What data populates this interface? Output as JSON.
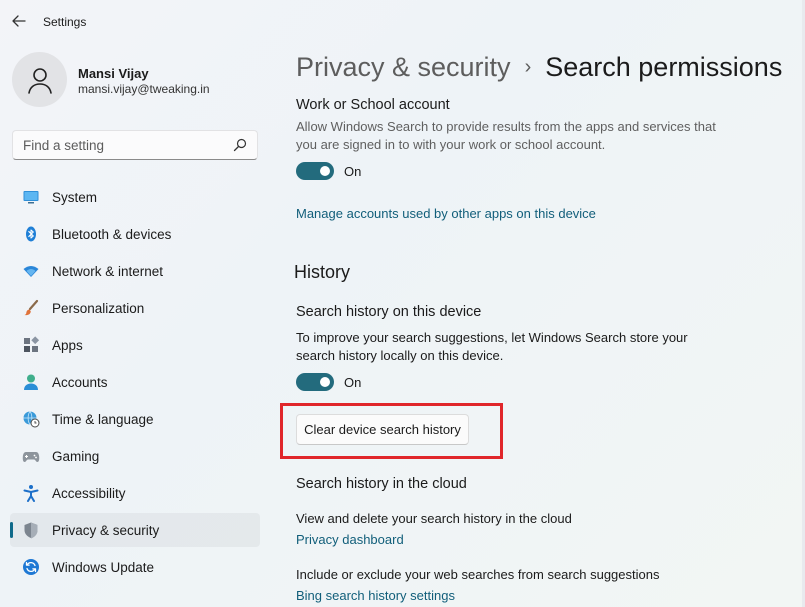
{
  "window": {
    "title": "Settings"
  },
  "user": {
    "name": "Mansi Vijay",
    "email": "mansi.vijay@tweaking.in"
  },
  "search": {
    "placeholder": "Find a setting"
  },
  "nav": {
    "items": [
      {
        "label": "System",
        "icon": "monitor-icon"
      },
      {
        "label": "Bluetooth & devices",
        "icon": "bluetooth-icon"
      },
      {
        "label": "Network & internet",
        "icon": "wifi-icon"
      },
      {
        "label": "Personalization",
        "icon": "brush-icon"
      },
      {
        "label": "Apps",
        "icon": "apps-icon"
      },
      {
        "label": "Accounts",
        "icon": "person-icon"
      },
      {
        "label": "Time & language",
        "icon": "globe-clock-icon"
      },
      {
        "label": "Gaming",
        "icon": "gamepad-icon"
      },
      {
        "label": "Accessibility",
        "icon": "accessibility-icon"
      },
      {
        "label": "Privacy & security",
        "icon": "shield-icon",
        "active": true
      },
      {
        "label": "Windows Update",
        "icon": "update-icon"
      }
    ]
  },
  "breadcrumb": {
    "parent": "Privacy & security",
    "separator": "›",
    "current": "Search permissions"
  },
  "work_account": {
    "title": "Work or School account",
    "description": "Allow Windows Search to provide results from the apps and services that you are signed in to with your work or school account.",
    "toggle_label": "On",
    "link": "Manage accounts used by other apps on this device"
  },
  "history": {
    "section_title": "History",
    "device_title": "Search history on this device",
    "device_description": "To improve your search suggestions, let Windows Search store your search history locally on this device.",
    "toggle_label": "On",
    "clear_button": "Clear device search history",
    "cloud_title": "Search history in the cloud",
    "cloud_description": "View and delete your search history in the cloud",
    "cloud_link": "Privacy dashboard",
    "include_description": "Include or exclude your web searches from search suggestions",
    "include_link": "Bing search history settings"
  },
  "colors": {
    "accent": "#236b7d",
    "link": "#115e7a",
    "highlight": "#e0262a"
  }
}
